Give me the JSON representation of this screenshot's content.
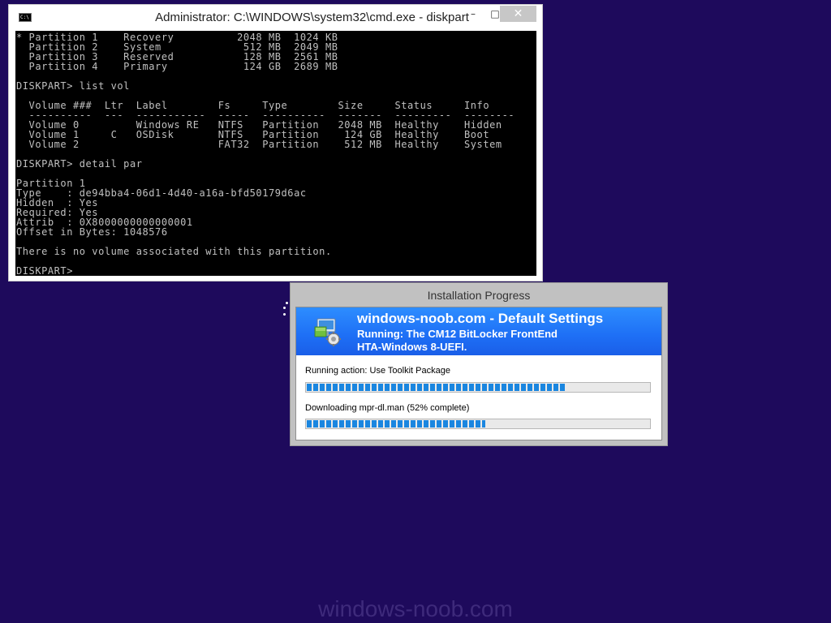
{
  "cmd_window": {
    "title": "Administrator: C:\\WINDOWS\\system32\\cmd.exe - diskpart",
    "app_icon": "cmd-icon",
    "app_icon_text": "C:\\",
    "controls": {
      "minimize": "–",
      "maximize": "□",
      "close": "✕"
    },
    "console_text": "* Partition 1    Recovery          2048 MB  1024 KB\n  Partition 2    System             512 MB  2049 MB\n  Partition 3    Reserved           128 MB  2561 MB\n  Partition 4    Primary            124 GB  2689 MB\n\nDISKPART> list vol\n\n  Volume ###  Ltr  Label        Fs     Type        Size     Status     Info\n  ----------  ---  -----------  -----  ----------  -------  ---------  --------\n  Volume 0         Windows RE   NTFS   Partition   2048 MB  Healthy    Hidden\n  Volume 1     C   OSDisk       NTFS   Partition    124 GB  Healthy    Boot\n  Volume 2                      FAT32  Partition    512 MB  Healthy    System\n\nDISKPART> detail par\n\nPartition 1\nType    : de94bba4-06d1-4d40-a16a-bfd50179d6ac\nHidden  : Yes\nRequired: Yes\nAttrib  : 0X8000000000000001\nOffset in Bytes: 1048576\n\nThere is no volume associated with this partition.\n\nDISKPART>"
  },
  "install_window": {
    "title": "Installation Progress",
    "banner": {
      "icon": "install-package-icon",
      "title": "windows-noob.com - Default Settings",
      "line1": "Running: The CM12 BitLocker FrontEnd",
      "line2": "HTA-Windows 8-UEFI."
    },
    "action_text": "Running action: Use Toolkit Package",
    "action_progress": 0.75,
    "download_text": "Downloading mpr-dl.man (52% complete)",
    "download_progress": 0.52
  },
  "desktop": {
    "background_color": "#1e0a5c",
    "busy_indicator": "busy-dots-icon",
    "watermark": "windows-noob.com"
  }
}
